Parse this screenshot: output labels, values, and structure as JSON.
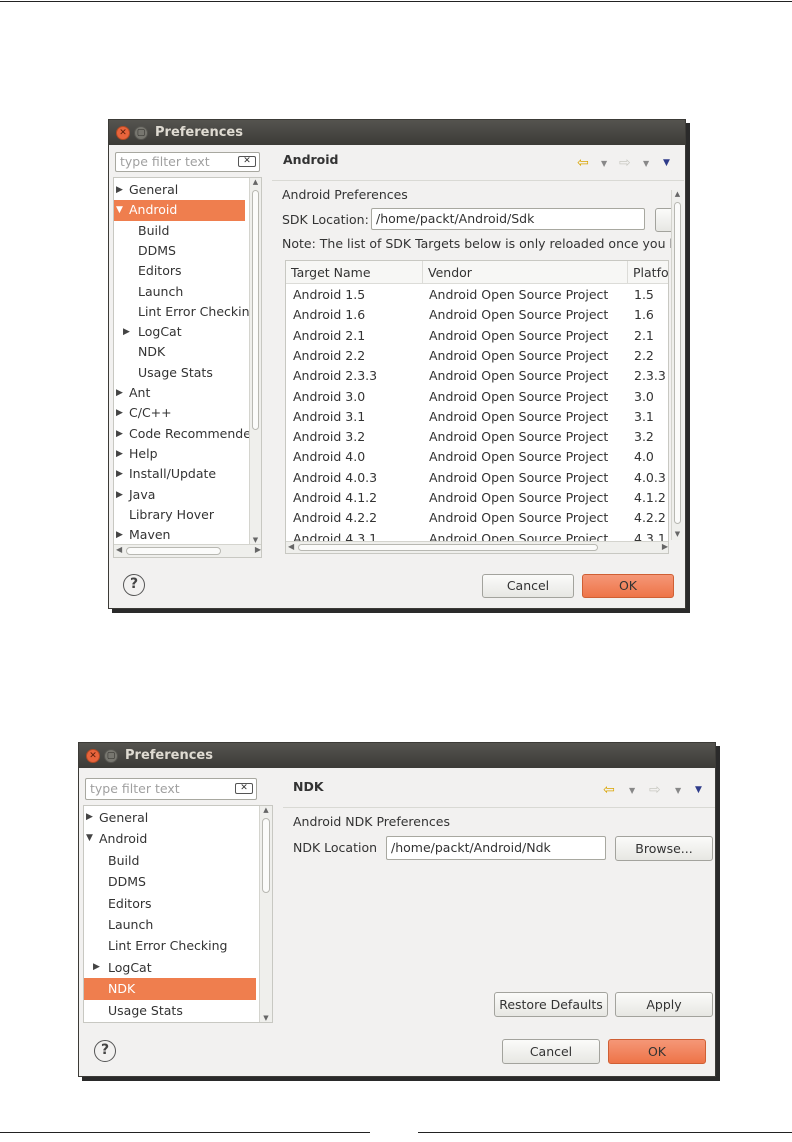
{
  "window1": {
    "title": "Preferences",
    "filter_placeholder": "type filter text",
    "tree": [
      {
        "label": "General",
        "arrow": "▶",
        "level": 0
      },
      {
        "label": "Android",
        "arrow": "▼",
        "level": 0,
        "selected": true
      },
      {
        "label": "Build",
        "arrow": "",
        "level": 1
      },
      {
        "label": "DDMS",
        "arrow": "",
        "level": 1
      },
      {
        "label": "Editors",
        "arrow": "",
        "level": 1
      },
      {
        "label": "Launch",
        "arrow": "",
        "level": 1
      },
      {
        "label": "Lint Error Checking",
        "arrow": "",
        "level": 1
      },
      {
        "label": "LogCat",
        "arrow": "▶",
        "level": 1
      },
      {
        "label": "NDK",
        "arrow": "",
        "level": 1
      },
      {
        "label": "Usage Stats",
        "arrow": "",
        "level": 1
      },
      {
        "label": "Ant",
        "arrow": "▶",
        "level": 0
      },
      {
        "label": "C/C++",
        "arrow": "▶",
        "level": 0
      },
      {
        "label": "Code Recommenders",
        "arrow": "▶",
        "level": 0
      },
      {
        "label": "Help",
        "arrow": "▶",
        "level": 0
      },
      {
        "label": "Install/Update",
        "arrow": "▶",
        "level": 0
      },
      {
        "label": "Java",
        "arrow": "▶",
        "level": 0
      },
      {
        "label": "Library Hover",
        "arrow": "",
        "level": 0
      },
      {
        "label": "Maven",
        "arrow": "▶",
        "level": 0
      }
    ],
    "panel_title": "Android",
    "section_label": "Android Preferences",
    "sdk_label": "SDK Location:",
    "sdk_value": "/home/packt/Android/Sdk",
    "note": "Note: The list of SDK Targets below is only reloaded once you hit 'A",
    "table_headers": [
      "Target Name",
      "Vendor",
      "Platfo"
    ],
    "table_rows": [
      [
        "Android 1.5",
        "Android Open Source Project",
        "1.5"
      ],
      [
        "Android 1.6",
        "Android Open Source Project",
        "1.6"
      ],
      [
        "Android 2.1",
        "Android Open Source Project",
        "2.1"
      ],
      [
        "Android 2.2",
        "Android Open Source Project",
        "2.2"
      ],
      [
        "Android 2.3.3",
        "Android Open Source Project",
        "2.3.3"
      ],
      [
        "Android 3.0",
        "Android Open Source Project",
        "3.0"
      ],
      [
        "Android 3.1",
        "Android Open Source Project",
        "3.1"
      ],
      [
        "Android 3.2",
        "Android Open Source Project",
        "3.2"
      ],
      [
        "Android 4.0",
        "Android Open Source Project",
        "4.0"
      ],
      [
        "Android 4.0.3",
        "Android Open Source Project",
        "4.0.3"
      ],
      [
        "Android 4.1.2",
        "Android Open Source Project",
        "4.1.2"
      ],
      [
        "Android 4.2.2",
        "Android Open Source Project",
        "4.2.2"
      ],
      [
        "Android 4.3.1",
        "Android Open Source Project",
        "4.3.1"
      ]
    ],
    "cancel_label": "Cancel",
    "ok_label": "OK"
  },
  "window2": {
    "title": "Preferences",
    "filter_placeholder": "type filter text",
    "tree": [
      {
        "label": "General",
        "arrow": "▶",
        "level": 0
      },
      {
        "label": "Android",
        "arrow": "▼",
        "level": 0
      },
      {
        "label": "Build",
        "arrow": "",
        "level": 1
      },
      {
        "label": "DDMS",
        "arrow": "",
        "level": 1
      },
      {
        "label": "Editors",
        "arrow": "",
        "level": 1
      },
      {
        "label": "Launch",
        "arrow": "",
        "level": 1
      },
      {
        "label": "Lint Error Checking",
        "arrow": "",
        "level": 1
      },
      {
        "label": "LogCat",
        "arrow": "▶",
        "level": 1
      },
      {
        "label": "NDK",
        "arrow": "",
        "level": 1,
        "selected": true
      },
      {
        "label": "Usage Stats",
        "arrow": "",
        "level": 1
      }
    ],
    "panel_title": "NDK",
    "section_label": "Android NDK Preferences",
    "ndk_label": "NDK Location",
    "ndk_value": "/home/packt/Android/Ndk",
    "browse_label": "Browse...",
    "restore_label": "Restore Defaults",
    "apply_label": "Apply",
    "cancel_label": "Cancel",
    "ok_label": "OK"
  }
}
